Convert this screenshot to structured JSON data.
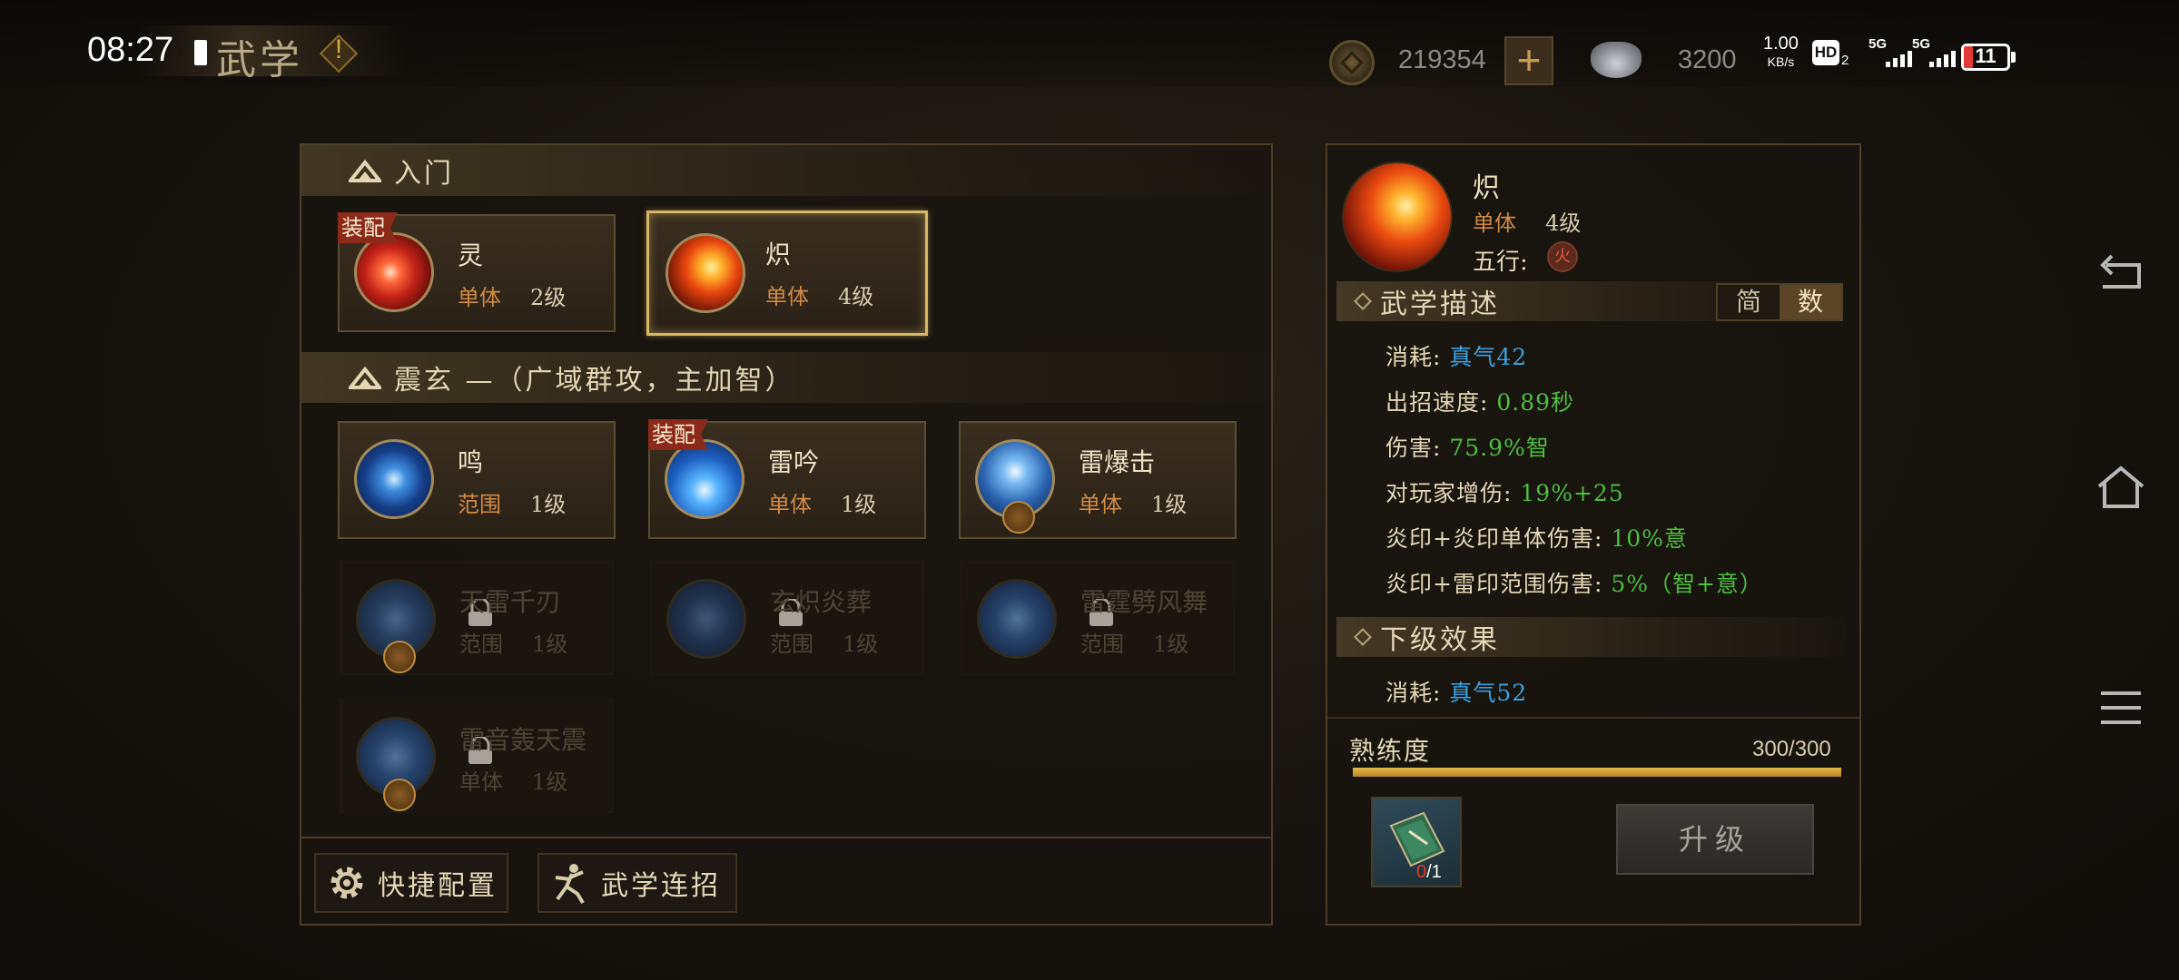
{
  "status_bar": {
    "time": "08:27",
    "net_speed_value": "1.00",
    "net_speed_unit": "KB/s",
    "hd_label": "HD",
    "hd_sub": "2",
    "signal1_label": "5G",
    "signal2_label": "5G",
    "battery": "11"
  },
  "header": {
    "title": "武学",
    "alert_mark": "!",
    "copper_count": "219354",
    "add_symbol": "+",
    "silver_count": "3200"
  },
  "sections": [
    {
      "title": "入门",
      "skills": [
        {
          "name": "灵",
          "type": "单体",
          "level": "2级",
          "equipped": true,
          "equip_label": "装配"
        },
        {
          "name": "炽",
          "type": "单体",
          "level": "4级",
          "selected": true
        }
      ]
    },
    {
      "title": "震玄 —（广域群攻，主加智）",
      "skills": [
        {
          "name": "鸣",
          "type": "范围",
          "level": "1级"
        },
        {
          "name": "雷吟",
          "type": "单体",
          "level": "1级",
          "equipped": true,
          "equip_label": "装配"
        },
        {
          "name": "雷爆击",
          "type": "单体",
          "level": "1级"
        },
        {
          "name": "天雷千刃",
          "type": "范围",
          "level": "1级",
          "locked": true
        },
        {
          "name": "玄炽炎葬",
          "type": "范围",
          "level": "1级",
          "locked": true
        },
        {
          "name": "雷霆劈风舞",
          "type": "范围",
          "level": "1级",
          "locked": true
        },
        {
          "name": "雷音轰天震",
          "type": "单体",
          "level": "1级",
          "locked": true
        }
      ]
    }
  ],
  "bottom_buttons": {
    "quick_config": "快捷配置",
    "combo": "武学连招"
  },
  "detail": {
    "name": "炽",
    "type": "单体",
    "level": "4级",
    "wuxing_label": "五行:",
    "wuxing_value": "火",
    "desc_title": "武学描述",
    "toggle_simple": "简",
    "toggle_numeric": "数",
    "stats": [
      {
        "label": "消耗:",
        "value": "真气42",
        "color": "blue"
      },
      {
        "label": "出招速度:",
        "value": "0.89秒",
        "color": "green"
      },
      {
        "label": "伤害:",
        "value": "75.9%智",
        "color": "green"
      },
      {
        "label": "对玩家增伤:",
        "value": "19%+25",
        "color": "green"
      },
      {
        "label": "炎印+炎印单体伤害:",
        "value": "10%意",
        "color": "green"
      },
      {
        "label": "炎印+雷印范围伤害:",
        "value": "5%（智+意）",
        "color": "green"
      }
    ],
    "next_title": "下级效果",
    "next_stats": [
      {
        "label": "消耗:",
        "value": "真气52",
        "color": "blue"
      }
    ],
    "proficiency_label": "熟练度",
    "proficiency_value": "300/300",
    "proficiency_fraction": 1.0,
    "item_have": "0",
    "item_need": "/1",
    "upgrade_label": "升级"
  },
  "colors": {
    "accent_gold": "#d8b765",
    "type_orange": "#d28b44",
    "value_blue": "#3ba1e2",
    "value_green": "#4fbf3e",
    "equip_red": "#8c2a1a"
  }
}
